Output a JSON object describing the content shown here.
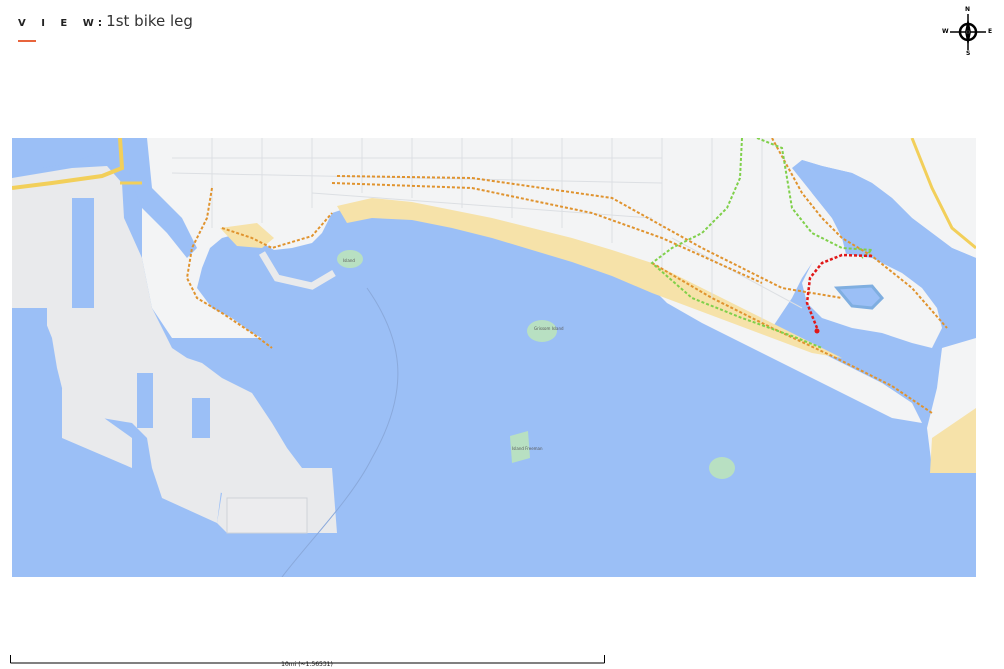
{
  "header": {
    "view_label": "V I E W",
    "separator": ":",
    "title": "1st bike leg"
  },
  "compass": {
    "north": "N",
    "south": "S",
    "east": "E",
    "west": "W"
  },
  "map": {
    "colors": {
      "water": "#9bbff6",
      "land": "#f3f4f5",
      "port_land": "#e9eaec",
      "sand": "#f6e2a9",
      "park": "#b8e0c2",
      "highway": "#f2cf5a",
      "route_orange": "#e0932e",
      "route_green": "#7fd04a",
      "route_red": "#e01818"
    },
    "labels": {
      "breakwater_island": "Grissom Island",
      "queen": "Island",
      "park_island": "Island Freeman"
    }
  },
  "scale": {
    "label": "10mi (~1:56531)"
  }
}
